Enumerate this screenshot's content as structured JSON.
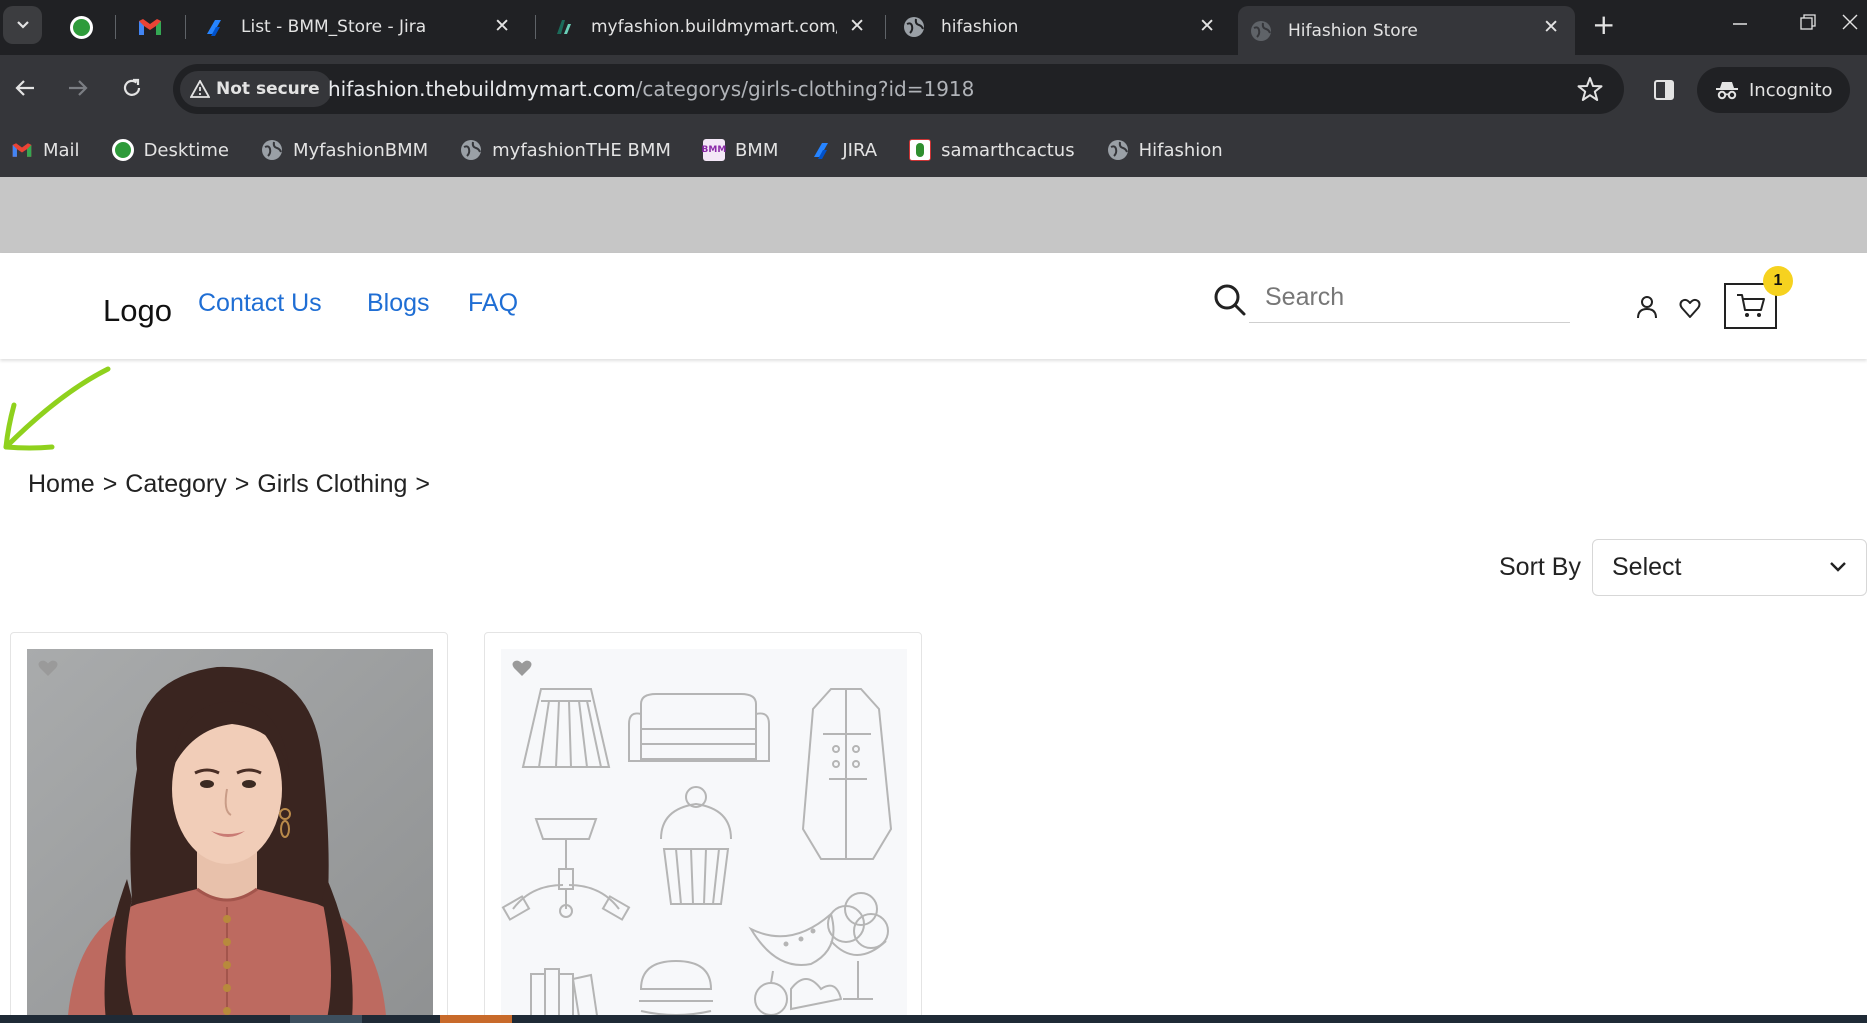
{
  "browser": {
    "tabs": [
      {
        "label": "",
        "icon": "desktime-icon"
      },
      {
        "label": "",
        "icon": "gmail-icon"
      },
      {
        "label": "List - BMM_Store - Jira",
        "icon": "jira-icon"
      },
      {
        "label": "myfashion.buildmymart.com/c",
        "icon": "page-icon"
      },
      {
        "label": "hifashion",
        "icon": "globe-icon"
      },
      {
        "label": "Hifashion Store",
        "icon": "globe-icon",
        "active": true
      }
    ],
    "security_label": "Not secure",
    "url_host": "hifashion.thebuildmymart.com",
    "url_path": "/categorys/girls-clothing?id=1918",
    "profile_label": "Incognito",
    "bookmarks": [
      {
        "label": "Mail",
        "icon": "gmail-icon"
      },
      {
        "label": "Desktime",
        "icon": "desktime-icon"
      },
      {
        "label": "MyfashionBMM",
        "icon": "globe-icon"
      },
      {
        "label": "myfashionTHE BMM",
        "icon": "globe-icon"
      },
      {
        "label": "BMM",
        "icon": "bmm-icon"
      },
      {
        "label": "JIRA",
        "icon": "jira-icon"
      },
      {
        "label": "samarthcactus",
        "icon": "cactus-icon"
      },
      {
        "label": "Hifashion",
        "icon": "globe-icon"
      }
    ]
  },
  "header": {
    "logo": "Logo",
    "nav": [
      "Contact Us",
      "Blogs",
      "FAQ"
    ],
    "search_placeholder": "Search",
    "cart_count": "1"
  },
  "breadcrumb": [
    "Home",
    ">",
    "Category",
    ">",
    "Girls Clothing",
    ">"
  ],
  "sort": {
    "label": "Sort By",
    "selected": "Select"
  },
  "products": [
    {
      "image": "woman-in-rose-top"
    },
    {
      "image": "placeholder-category-doodles"
    }
  ],
  "colors": {
    "link": "#1f6ed4",
    "badge": "#f6d21f",
    "annotation_arrow": "#8fd11d",
    "browser_frame": "#202124"
  }
}
